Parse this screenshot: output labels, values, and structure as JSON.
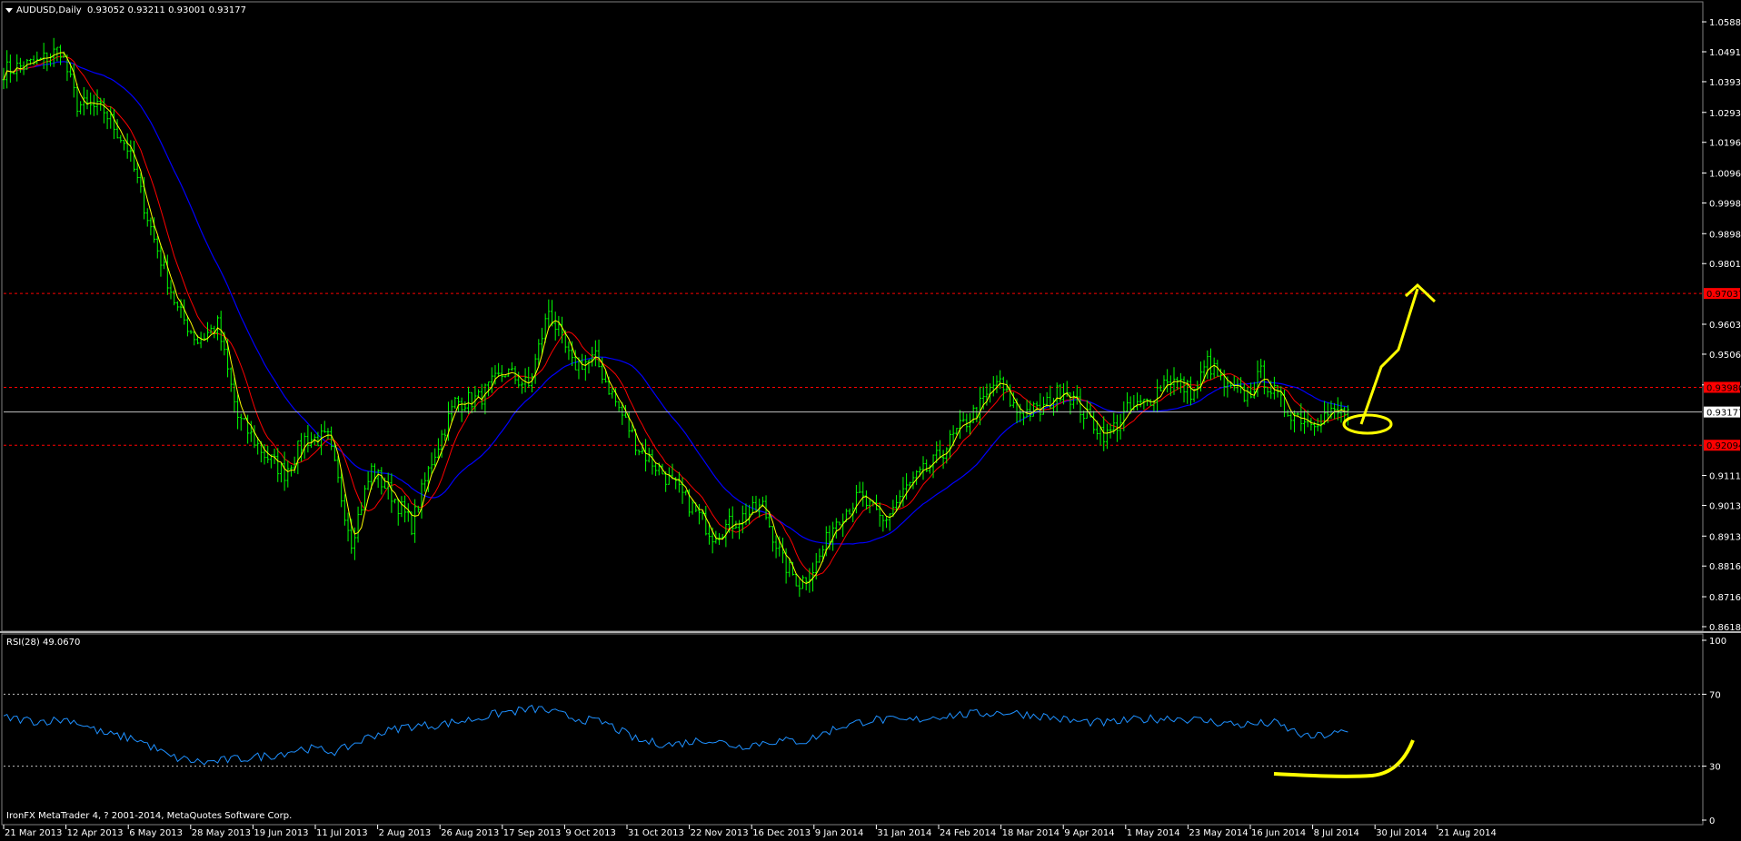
{
  "chart_data": [
    {
      "type": "candlestick",
      "title": "AUDUSD,Daily",
      "ohlc_readout": "0.93052 0.93211 0.93001 0.93177",
      "last_price": "0.93177",
      "ylim": [
        0.86185,
        1.063
      ],
      "y_ticks": [
        "1.05885",
        "1.04910",
        "1.03935",
        "1.02935",
        "1.01960",
        "1.00960",
        "0.99985",
        "0.98985",
        "0.98010",
        "0.96035",
        "0.95060",
        "0.94060",
        "0.91110",
        "0.90135",
        "0.89135",
        "0.88160",
        "0.87160",
        "0.86185"
      ],
      "resistance_levels": [
        {
          "label": "0.97037",
          "value": 0.97037
        },
        {
          "label": "0.93980",
          "value": 0.9398
        },
        {
          "label": "0.92094",
          "value": 0.92094
        }
      ],
      "x_tick_labels": [
        "21 Mar 2013",
        "12 Apr 2013",
        "6 May 2013",
        "28 May 2013",
        "19 Jun 2013",
        "11 Jul 2013",
        "2 Aug 2013",
        "26 Aug 2013",
        "17 Sep 2013",
        "9 Oct 2013",
        "31 Oct 2013",
        "22 Nov 2013",
        "16 Dec 2013",
        "9 Jan 2014",
        "31 Jan 2014",
        "24 Feb 2014",
        "18 Mar 2014",
        "9 Apr 2014",
        "1 May 2014",
        "23 May 2014",
        "16 Jun 2014",
        "8 Jul 2014",
        "30 Jul 2014",
        "21 Aug 2014"
      ],
      "close_path": [
        {
          "bar": 0,
          "close": 1.043
        },
        {
          "bar": 10,
          "close": 1.0455
        },
        {
          "bar": 17,
          "close": 1.05
        },
        {
          "bar": 22,
          "close": 1.032
        },
        {
          "bar": 30,
          "close": 1.03
        },
        {
          "bar": 37,
          "close": 1.018
        },
        {
          "bar": 45,
          "close": 0.988
        },
        {
          "bar": 52,
          "close": 0.965
        },
        {
          "bar": 58,
          "close": 0.955
        },
        {
          "bar": 64,
          "close": 0.96
        },
        {
          "bar": 70,
          "close": 0.93
        },
        {
          "bar": 78,
          "close": 0.918
        },
        {
          "bar": 84,
          "close": 0.912
        },
        {
          "bar": 90,
          "close": 0.923
        },
        {
          "bar": 97,
          "close": 0.923
        },
        {
          "bar": 104,
          "close": 0.89
        },
        {
          "bar": 110,
          "close": 0.913
        },
        {
          "bar": 116,
          "close": 0.905
        },
        {
          "bar": 122,
          "close": 0.895
        },
        {
          "bar": 128,
          "close": 0.916
        },
        {
          "bar": 135,
          "close": 0.935
        },
        {
          "bar": 142,
          "close": 0.936
        },
        {
          "bar": 150,
          "close": 0.945
        },
        {
          "bar": 157,
          "close": 0.94
        },
        {
          "bar": 163,
          "close": 0.965
        },
        {
          "bar": 170,
          "close": 0.947
        },
        {
          "bar": 177,
          "close": 0.949
        },
        {
          "bar": 183,
          "close": 0.935
        },
        {
          "bar": 190,
          "close": 0.92
        },
        {
          "bar": 197,
          "close": 0.912
        },
        {
          "bar": 205,
          "close": 0.902
        },
        {
          "bar": 212,
          "close": 0.892
        },
        {
          "bar": 220,
          "close": 0.897
        },
        {
          "bar": 227,
          "close": 0.901
        },
        {
          "bar": 233,
          "close": 0.883
        },
        {
          "bar": 238,
          "close": 0.876
        },
        {
          "bar": 243,
          "close": 0.882
        },
        {
          "bar": 249,
          "close": 0.897
        },
        {
          "bar": 256,
          "close": 0.904
        },
        {
          "bar": 263,
          "close": 0.896
        },
        {
          "bar": 270,
          "close": 0.907
        },
        {
          "bar": 278,
          "close": 0.915
        },
        {
          "bar": 285,
          "close": 0.925
        },
        {
          "bar": 293,
          "close": 0.935
        },
        {
          "bar": 297,
          "close": 0.942
        },
        {
          "bar": 303,
          "close": 0.932
        },
        {
          "bar": 310,
          "close": 0.932
        },
        {
          "bar": 317,
          "close": 0.94
        },
        {
          "bar": 324,
          "close": 0.93
        },
        {
          "bar": 330,
          "close": 0.924
        },
        {
          "bar": 336,
          "close": 0.932
        },
        {
          "bar": 342,
          "close": 0.935
        },
        {
          "bar": 348,
          "close": 0.943
        },
        {
          "bar": 356,
          "close": 0.938
        },
        {
          "bar": 360,
          "close": 0.948
        },
        {
          "bar": 366,
          "close": 0.939
        },
        {
          "bar": 372,
          "close": 0.937
        },
        {
          "bar": 376,
          "close": 0.944
        },
        {
          "bar": 383,
          "close": 0.933
        },
        {
          "bar": 390,
          "close": 0.929
        },
        {
          "bar": 396,
          "close": 0.931
        },
        {
          "bar": 402,
          "close": 0.9318
        }
      ]
    },
    {
      "type": "line",
      "title": "RSI(28) 49.0670",
      "ylim": [
        0,
        100
      ],
      "levels": [
        "70",
        "30"
      ],
      "y_ticks": [
        "100",
        "70",
        "30",
        "0"
      ],
      "rsi_path": [
        {
          "bar": 0,
          "value": 57
        },
        {
          "bar": 10,
          "value": 55
        },
        {
          "bar": 20,
          "value": 56
        },
        {
          "bar": 30,
          "value": 48
        },
        {
          "bar": 40,
          "value": 45
        },
        {
          "bar": 50,
          "value": 35
        },
        {
          "bar": 60,
          "value": 32
        },
        {
          "bar": 70,
          "value": 34
        },
        {
          "bar": 80,
          "value": 36
        },
        {
          "bar": 90,
          "value": 40
        },
        {
          "bar": 100,
          "value": 38
        },
        {
          "bar": 110,
          "value": 47
        },
        {
          "bar": 120,
          "value": 52
        },
        {
          "bar": 130,
          "value": 53
        },
        {
          "bar": 140,
          "value": 56
        },
        {
          "bar": 150,
          "value": 60
        },
        {
          "bar": 160,
          "value": 62
        },
        {
          "bar": 170,
          "value": 57
        },
        {
          "bar": 180,
          "value": 54
        },
        {
          "bar": 190,
          "value": 44
        },
        {
          "bar": 200,
          "value": 42
        },
        {
          "bar": 210,
          "value": 45
        },
        {
          "bar": 220,
          "value": 41
        },
        {
          "bar": 230,
          "value": 44
        },
        {
          "bar": 240,
          "value": 44
        },
        {
          "bar": 250,
          "value": 52
        },
        {
          "bar": 260,
          "value": 56
        },
        {
          "bar": 270,
          "value": 55
        },
        {
          "bar": 280,
          "value": 58
        },
        {
          "bar": 290,
          "value": 59
        },
        {
          "bar": 300,
          "value": 60
        },
        {
          "bar": 310,
          "value": 58
        },
        {
          "bar": 320,
          "value": 55
        },
        {
          "bar": 330,
          "value": 54
        },
        {
          "bar": 340,
          "value": 56
        },
        {
          "bar": 350,
          "value": 57
        },
        {
          "bar": 360,
          "value": 55
        },
        {
          "bar": 370,
          "value": 53
        },
        {
          "bar": 380,
          "value": 54
        },
        {
          "bar": 390,
          "value": 46
        },
        {
          "bar": 402,
          "value": 49
        }
      ]
    }
  ],
  "footer": "IronFX MetaTrader 4, ? 2001-2014, MetaQuotes Software Corp.",
  "colors": {
    "background": "#000000",
    "bull_bar": "#00ff00",
    "ma_fast": "#ffff00",
    "ma_mid": "#ff0000",
    "ma_slow": "#0000ff",
    "rsi_line": "#1e90ff",
    "level_line": "#ff0000",
    "annotation": "#ffff00",
    "price_tag_bg": "#ff0000"
  }
}
